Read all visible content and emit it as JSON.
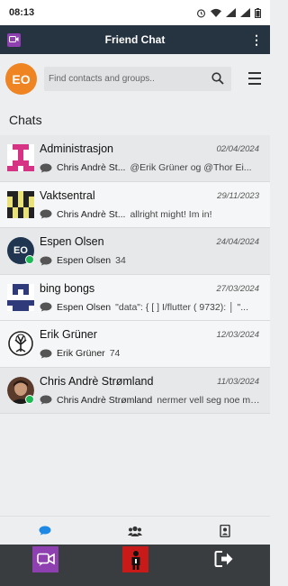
{
  "status_bar": {
    "time": "08:13"
  },
  "app": {
    "title": "Friend Chat"
  },
  "user": {
    "initials": "EO",
    "avatar_color": "#ee8422"
  },
  "search": {
    "placeholder": "Find contacts and groups.."
  },
  "section_title": "Chats",
  "chats": [
    {
      "name": "Administrasjon",
      "date": "02/04/2024",
      "sender": "Chris Andrè St...",
      "message": "@Erik Grüner og @Thor Ei...",
      "avatar": "identicon-magenta",
      "online": false
    },
    {
      "name": "Vaktsentral",
      "date": "29/11/2023",
      "sender": "Chris Andrè St...",
      "message": "allright might! Im in!",
      "avatar": "identicon-yellow",
      "online": false
    },
    {
      "name": "Espen Olsen",
      "date": "24/04/2024",
      "sender": "Espen Olsen",
      "message": "34",
      "avatar": "initials-eo",
      "avatar_initials": "EO",
      "online": true
    },
    {
      "name": "bing bongs",
      "date": "27/03/2024",
      "sender": "Espen Olsen",
      "message": "\"data\": { [ ] I/flutter ( 9732): │ \"...",
      "avatar": "identicon-navy",
      "online": false
    },
    {
      "name": "Erik Grüner",
      "date": "12/03/2024",
      "sender": "Erik Grüner",
      "message": "74",
      "avatar": "tree-logo",
      "online": false
    },
    {
      "name": "Chris Andrè Strømland",
      "date": "11/03/2024",
      "sender": "Chris Andrè Strømland",
      "message": "nermer vell seg noe med ...",
      "avatar": "photo",
      "online": true
    }
  ],
  "bottom_nav": [
    "chat-icon",
    "group-icon",
    "contacts-icon"
  ],
  "dock": [
    "chat-app-icon",
    "profile-icon",
    "logout-icon"
  ],
  "colors": {
    "app_bar": "#263341",
    "accent": "#1e88e5",
    "brand_purple": "#8e3fb0",
    "online": "#1db954"
  }
}
